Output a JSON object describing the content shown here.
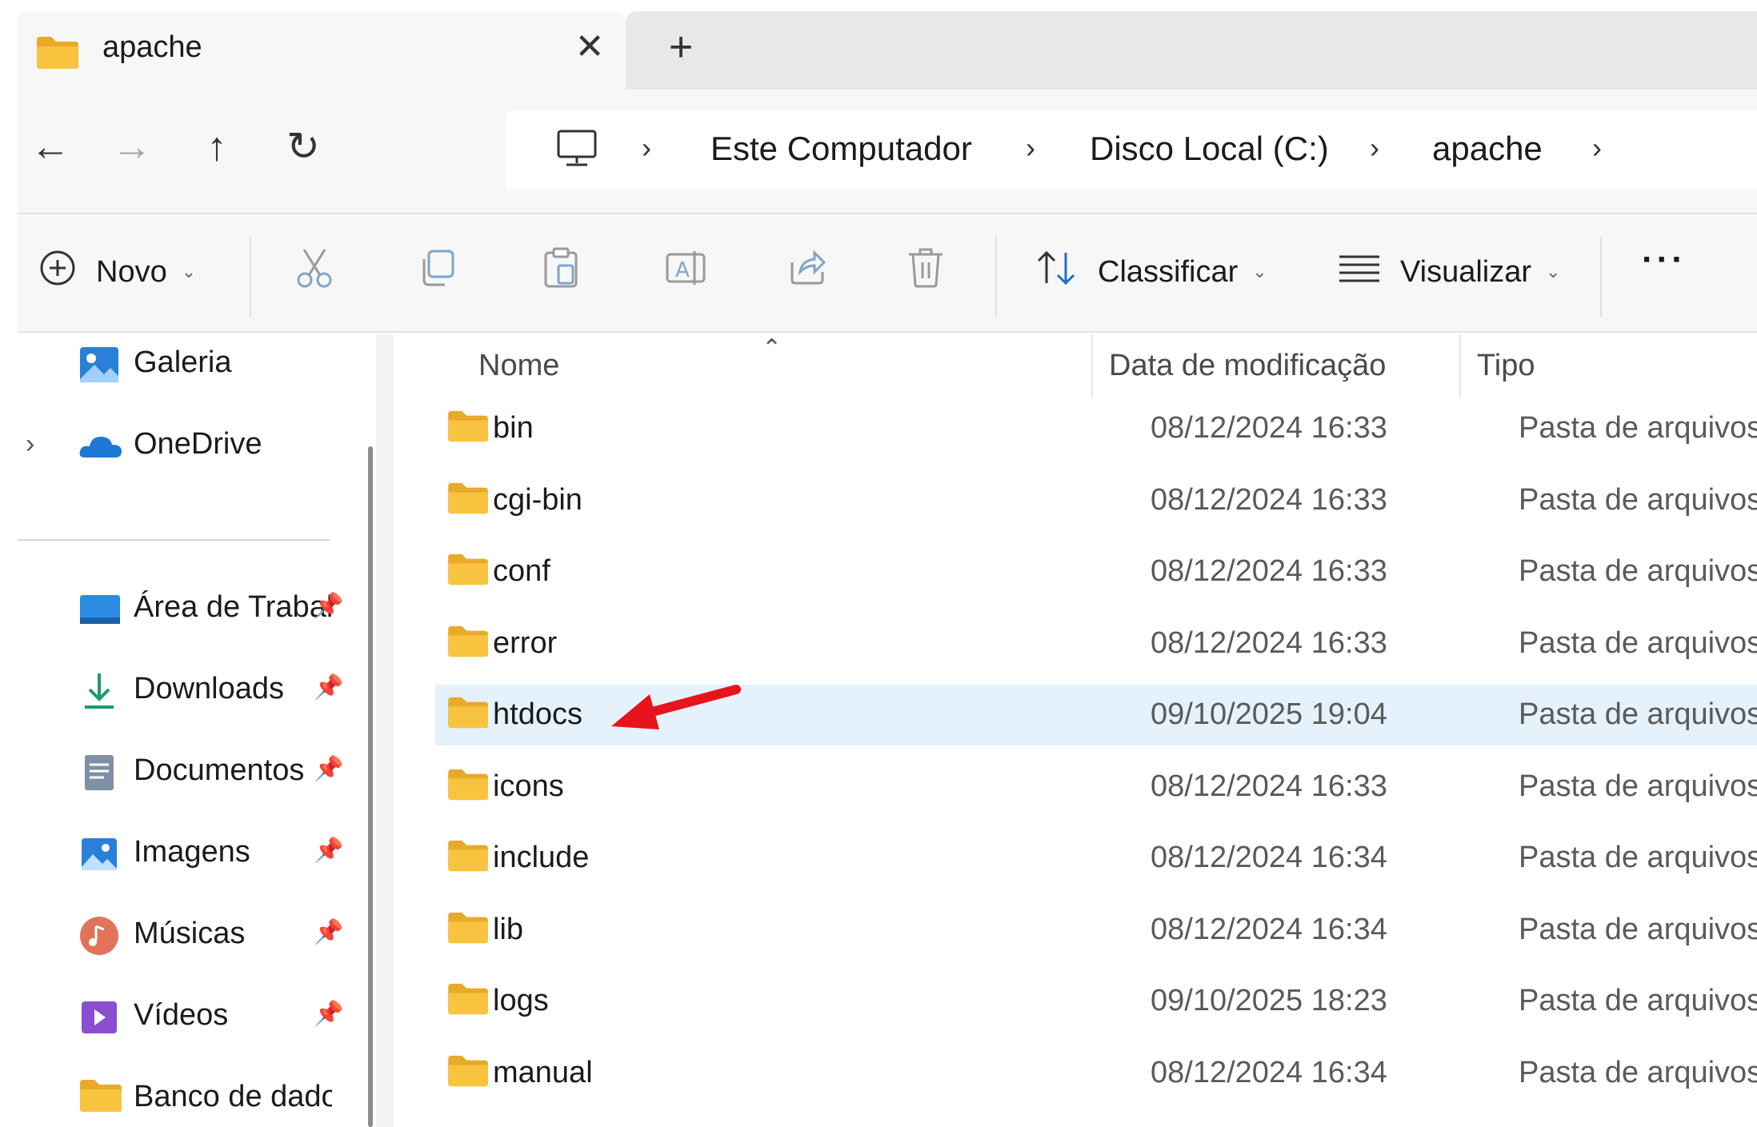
{
  "tab": {
    "title": "apache",
    "close": "✕",
    "new": "+"
  },
  "nav": {
    "back": "←",
    "forward": "→",
    "up": "↑",
    "refresh": "↻"
  },
  "breadcrumb": [
    {
      "label": "Este Computador"
    },
    {
      "label": "Disco Local (C:)"
    },
    {
      "label": "apache"
    }
  ],
  "chevron": "›",
  "toolbar": {
    "new_label": "Novo",
    "sort_label": "Classificar",
    "view_label": "Visualizar",
    "more": "···"
  },
  "sidebar": {
    "items": [
      {
        "label": "Galeria"
      },
      {
        "label": "OneDrive"
      },
      {
        "label": "Área de Trabalho"
      },
      {
        "label": "Downloads"
      },
      {
        "label": "Documentos"
      },
      {
        "label": "Imagens"
      },
      {
        "label": "Músicas"
      },
      {
        "label": "Vídeos"
      },
      {
        "label": "Banco de dados"
      }
    ],
    "expander": "›",
    "pin": "📌"
  },
  "columns": {
    "name": "Nome",
    "date": "Data de modificação",
    "type": "Tipo"
  },
  "files": [
    {
      "name": "bin",
      "date": "08/12/2024 16:33",
      "type": "Pasta de arquivos"
    },
    {
      "name": "cgi-bin",
      "date": "08/12/2024 16:33",
      "type": "Pasta de arquivos"
    },
    {
      "name": "conf",
      "date": "08/12/2024 16:33",
      "type": "Pasta de arquivos"
    },
    {
      "name": "error",
      "date": "08/12/2024 16:33",
      "type": "Pasta de arquivos"
    },
    {
      "name": "htdocs",
      "date": "09/10/2025 19:04",
      "type": "Pasta de arquivos"
    },
    {
      "name": "icons",
      "date": "08/12/2024 16:33",
      "type": "Pasta de arquivos"
    },
    {
      "name": "include",
      "date": "08/12/2024 16:34",
      "type": "Pasta de arquivos"
    },
    {
      "name": "lib",
      "date": "08/12/2024 16:34",
      "type": "Pasta de arquivos"
    },
    {
      "name": "logs",
      "date": "09/10/2025 18:23",
      "type": "Pasta de arquivos"
    },
    {
      "name": "manual",
      "date": "08/12/2024 16:34",
      "type": "Pasta de arquivos"
    }
  ],
  "colors": {
    "selected_row": "#e5f1fb",
    "folder": "#f8c33f",
    "annotation_arrow": "#e8141b"
  }
}
